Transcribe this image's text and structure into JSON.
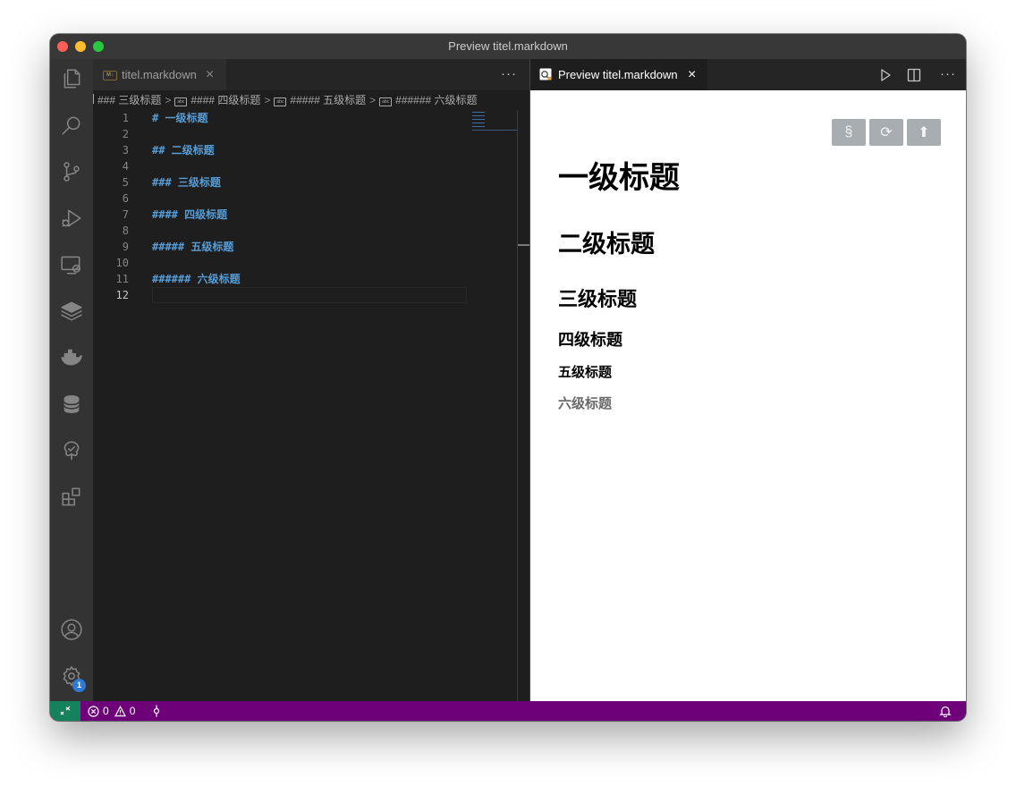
{
  "window": {
    "title": "Preview titel.markdown"
  },
  "activity_bar": {
    "items": [
      "files-icon",
      "search-icon",
      "source-control-icon",
      "run-debug-icon",
      "remote-explorer-icon",
      "layers-icon",
      "docker-icon",
      "database-icon",
      "tree-icon",
      "extensions-icon"
    ],
    "account": "account-icon",
    "settings": {
      "icon": "gear-icon",
      "badge": "1"
    }
  },
  "editor": {
    "tab": {
      "label": "titel.markdown",
      "icon": "markdown-icon",
      "icon_text": "M↓"
    },
    "more": "···",
    "breadcrumbs": [
      {
        "label": "### 三级标题",
        "icon": ""
      },
      {
        "label": "#### 四级标题",
        "icon": "abc"
      },
      {
        "label": "##### 五级标题",
        "icon": "abc"
      },
      {
        "label": "###### 六级标题",
        "icon": "abc"
      }
    ],
    "breadcrumb_sep": ">",
    "lines": [
      {
        "n": "1",
        "text": "# 一级标题"
      },
      {
        "n": "2",
        "text": ""
      },
      {
        "n": "3",
        "text": "## 二级标题"
      },
      {
        "n": "4",
        "text": ""
      },
      {
        "n": "5",
        "text": "### 三级标题"
      },
      {
        "n": "6",
        "text": ""
      },
      {
        "n": "7",
        "text": "#### 四级标题"
      },
      {
        "n": "8",
        "text": ""
      },
      {
        "n": "9",
        "text": "##### 五级标题"
      },
      {
        "n": "10",
        "text": ""
      },
      {
        "n": "11",
        "text": "###### 六级标题"
      },
      {
        "n": "12",
        "text": ""
      }
    ],
    "active_line": "12"
  },
  "preview": {
    "tab": {
      "label": "Preview titel.markdown"
    },
    "actions": {
      "run": "play-icon",
      "split": "split-editor-icon",
      "more": "···"
    },
    "buttons": {
      "section": "§",
      "refresh": "⟳",
      "top": "⬆"
    },
    "headings": {
      "h1": "一级标题",
      "h2": "二级标题",
      "h3": "三级标题",
      "h4": "四级标题",
      "h5": "五级标题",
      "h6": "六级标题"
    }
  },
  "status_bar": {
    "errors": "0",
    "warnings": "0",
    "colors": {
      "background": "#6e007a",
      "remote": "#16825d"
    }
  }
}
